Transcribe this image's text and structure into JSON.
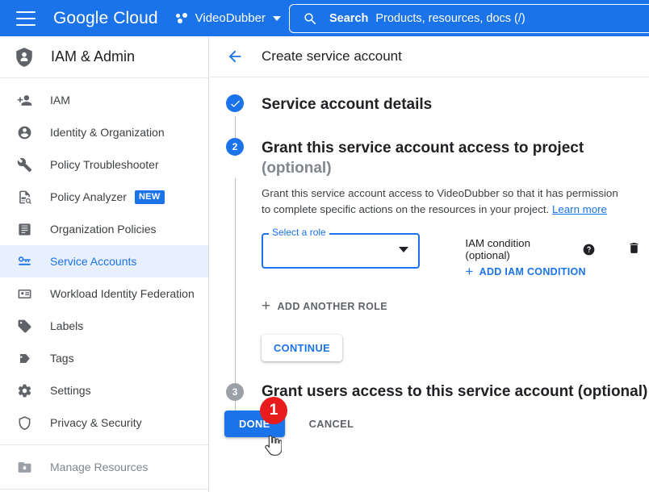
{
  "topbar": {
    "menu_icon": "hamburger-menu-icon",
    "logo_part1": "Google",
    "logo_part2": "Cloud",
    "project_name": "VideoDubber",
    "project_icon": "project-dots-icon",
    "project_caret": "chevron-down-icon",
    "search": {
      "icon": "search-icon",
      "label": "Search",
      "placeholder": "Products, resources, docs (/)"
    }
  },
  "sidebar": {
    "header": {
      "icon": "shield-person-icon",
      "title": "IAM & Admin"
    },
    "items": [
      {
        "label": "IAM",
        "icon": "person-add-icon",
        "state": "normal"
      },
      {
        "label": "Identity & Organization",
        "icon": "account-circle-icon",
        "state": "normal"
      },
      {
        "label": "Policy Troubleshooter",
        "icon": "wrench-icon",
        "state": "normal"
      },
      {
        "label": "Policy Analyzer",
        "icon": "document-search-icon",
        "state": "normal",
        "badge": "NEW"
      },
      {
        "label": "Organization Policies",
        "icon": "list-document-icon",
        "state": "normal"
      },
      {
        "label": "Service Accounts",
        "icon": "key-card-icon",
        "state": "active"
      },
      {
        "label": "Workload Identity Federation",
        "icon": "id-card-icon",
        "state": "normal"
      },
      {
        "label": "Labels",
        "icon": "label-tag-icon",
        "state": "normal"
      },
      {
        "label": "Tags",
        "icon": "tag-arrow-icon",
        "state": "normal"
      },
      {
        "label": "Settings",
        "icon": "gear-icon",
        "state": "normal"
      },
      {
        "label": "Privacy & Security",
        "icon": "shield-icon",
        "state": "normal"
      },
      {
        "label": "Manage Resources",
        "icon": "folder-gear-icon",
        "state": "dim",
        "divider_before": true
      }
    ]
  },
  "main": {
    "back_icon": "back-arrow-icon",
    "title": "Create service account",
    "steps": [
      {
        "number": "",
        "badge_state": "done",
        "badge_icon": "check-icon",
        "title": "Service account details",
        "optional": ""
      },
      {
        "number": "2",
        "badge_state": "current",
        "title": "Grant this service account access to project",
        "optional": "(optional)",
        "description_pre": "Grant this service account access to VideoDubber so that it has permission to complete specific actions on the resources in your project.",
        "description_link": "Learn more",
        "role_select": {
          "label": "Select a role",
          "value": "",
          "arrow_icon": "dropdown-arrow-icon"
        },
        "iam_condition": {
          "title": "IAM condition (optional)",
          "help_icon": "help-circle-icon",
          "add_label": "ADD IAM CONDITION",
          "add_icon": "plus-icon"
        },
        "delete_icon": "trash-icon",
        "add_another_role": "ADD ANOTHER ROLE",
        "continue_label": "CONTINUE"
      },
      {
        "number": "3",
        "badge_state": "todo",
        "title": "Grant users access to this service account",
        "optional": "(optional)"
      }
    ],
    "actions": {
      "done_label": "DONE",
      "cancel_label": "CANCEL",
      "marker_number": "1",
      "cursor_icon": "hand-pointer-cursor"
    }
  },
  "colors": {
    "brand_blue": "#1a73e8",
    "active_row_bg": "#e8f0fe",
    "marker_red": "#e81c1c",
    "todo_gray": "#9aa0a6",
    "text_primary": "#202124",
    "text_secondary": "#5f6368"
  }
}
